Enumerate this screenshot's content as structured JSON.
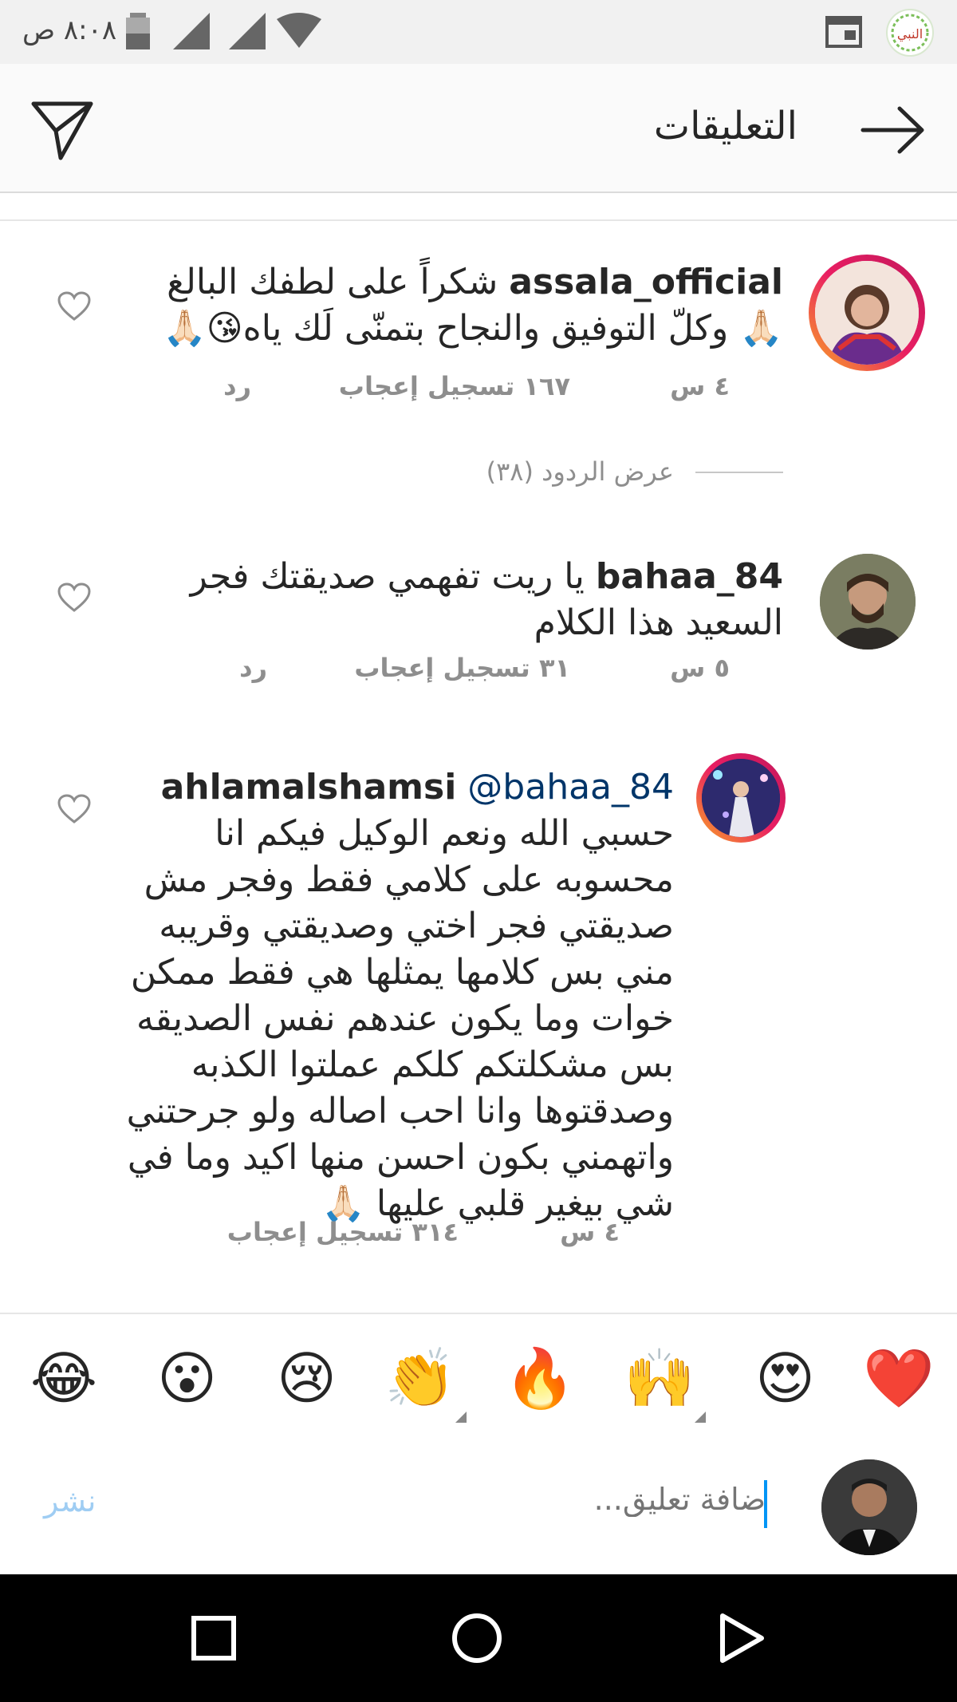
{
  "status_bar": {
    "time": "٨:٠٨ ص",
    "app_badge": "النبي"
  },
  "header": {
    "title": "التعليقات"
  },
  "comments": [
    {
      "username": "assala_official",
      "text": "شكراً على لطفك البالغ🙏🏻 وكلّ التوفيق والنجاح بتمنّى لَك ياه😘🙏🏻",
      "time": "٤ س",
      "likes": "١٦٧ تسجيل إعجاب",
      "reply": "رد",
      "view_replies": "عرض الردود (٣٨)"
    },
    {
      "username": "bahaa_84",
      "text": "يا ريت تفهمي صديقتك فجر السعيد هذا الكلام",
      "time": "٥ س",
      "likes": "٣١ تسجيل إعجاب",
      "reply": "رد"
    },
    {
      "username": "ahlamalshamsi",
      "mention": "@bahaa_84",
      "text": "حسبي الله ونعم الوكيل فيكم انا محسوبه على كلامي فقط وفجر مش صديقتي فجر اختي وصديقتي وقريبه مني بس كلامها يمثلها هي فقط ممكن خوات وما يكون عندهم نفس الصديقه بس مشكلتكم كلكم عملتوا الكذبه وصدقتوها وانا احب اصاله ولو جرحتني واتهمني بكون احسن منها اكيد وما في شي بيغير قلبي عليها 🙏🏻",
      "time": "٤ س",
      "likes": "٣١٤ تسجيل إعجاب"
    }
  ],
  "emoji_bar": [
    "❤️",
    "😍",
    "🙌",
    "🔥",
    "👏",
    "😢",
    "😮",
    "😂"
  ],
  "comment_input": {
    "placeholder": "ضافة تعليق...",
    "post_label": "نشر"
  },
  "colors": {
    "accent": "#0095f6",
    "meta_gray": "#8e8e8e",
    "mention": "#003569"
  }
}
